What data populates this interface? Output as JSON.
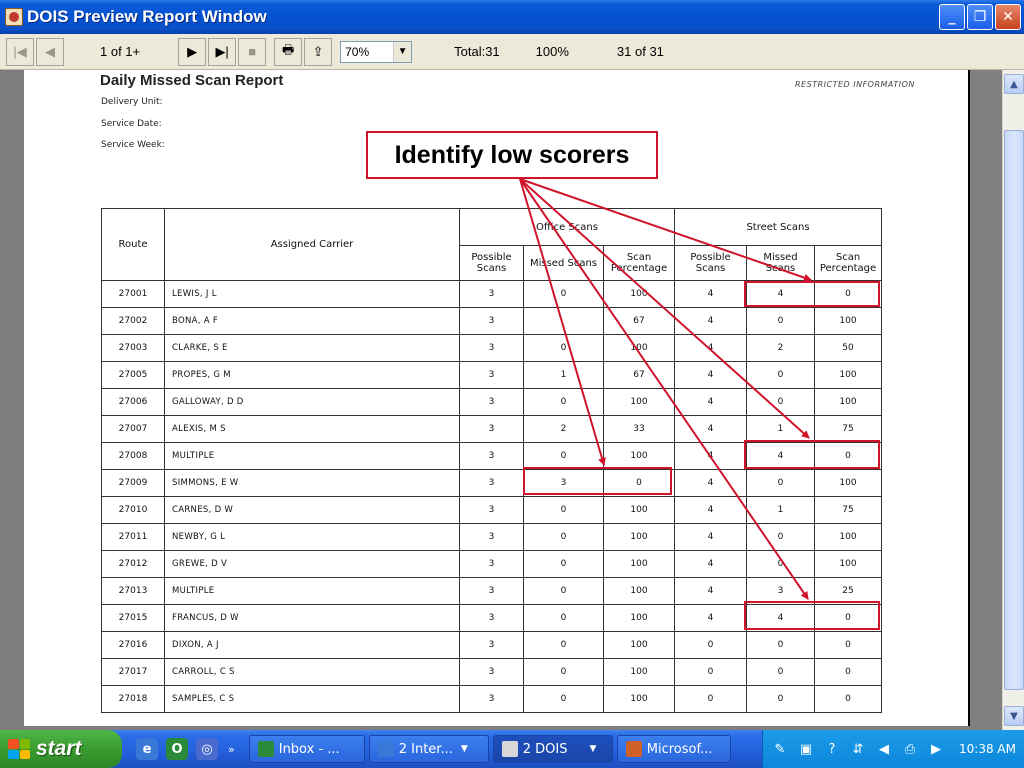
{
  "window": {
    "title": "DOIS Preview Report Window"
  },
  "toolbar": {
    "page_indicator": "1 of 1+",
    "zoom": "70%",
    "total": "Total:31",
    "percent": "100%",
    "count": "31 of 31"
  },
  "report": {
    "title": "Daily Missed Scan Report",
    "restricted": "RESTRICTED INFORMATION",
    "meta": [
      "Delivery Unit:",
      "Service Date:",
      "Service Week:"
    ],
    "headers": {
      "route": "Route",
      "carrier": "Assigned Carrier",
      "office": "Office Scans",
      "street": "Street Scans",
      "possible": "Possible Scans",
      "missed": "Missed Scans",
      "pct": "Scan Percentage"
    },
    "rows": [
      [
        "27001",
        "LEWIS, J L",
        "3",
        "0",
        "100",
        "4",
        "4",
        "0"
      ],
      [
        "27002",
        "BONA, A F",
        "3",
        "",
        "67",
        "4",
        "0",
        "100"
      ],
      [
        "27003",
        "CLARKE, S E",
        "3",
        "0",
        "100",
        "4",
        "2",
        "50"
      ],
      [
        "27005",
        "PROPES, G M",
        "3",
        "1",
        "67",
        "4",
        "0",
        "100"
      ],
      [
        "27006",
        "GALLOWAY, D D",
        "3",
        "0",
        "100",
        "4",
        "0",
        "100"
      ],
      [
        "27007",
        "ALEXIS, M S",
        "3",
        "2",
        "33",
        "4",
        "1",
        "75"
      ],
      [
        "27008",
        "MULTIPLE",
        "3",
        "0",
        "100",
        "4",
        "4",
        "0"
      ],
      [
        "27009",
        "SIMMONS, E W",
        "3",
        "3",
        "0",
        "4",
        "0",
        "100"
      ],
      [
        "27010",
        "CARNES, D W",
        "3",
        "0",
        "100",
        "4",
        "1",
        "75"
      ],
      [
        "27011",
        "NEWBY, G L",
        "3",
        "0",
        "100",
        "4",
        "0",
        "100"
      ],
      [
        "27012",
        "GREWE, D V",
        "3",
        "0",
        "100",
        "4",
        "0",
        "100"
      ],
      [
        "27013",
        "MULTIPLE",
        "3",
        "0",
        "100",
        "4",
        "3",
        "25"
      ],
      [
        "27015",
        "FRANCUS, D W",
        "3",
        "0",
        "100",
        "4",
        "4",
        "0"
      ],
      [
        "27016",
        "DIXON, A J",
        "3",
        "0",
        "100",
        "0",
        "0",
        "0"
      ],
      [
        "27017",
        "CARROLL, C S",
        "3",
        "0",
        "100",
        "0",
        "0",
        "0"
      ],
      [
        "27018",
        "SAMPLES, C S",
        "3",
        "0",
        "100",
        "0",
        "0",
        "0"
      ]
    ]
  },
  "callout": {
    "text": "Identify low scorers"
  },
  "taskbar": {
    "start": "start",
    "tasks": [
      {
        "label": "Inbox - ...",
        "icon_color": "#2a8a3a"
      },
      {
        "label": "2 Inter...",
        "icon_color": "#3a78d8"
      },
      {
        "label": "2 DOIS",
        "icon_color": "#d8d8d8"
      },
      {
        "label": "Microsof...",
        "icon_color": "#d0602a"
      }
    ],
    "clock": "10:38 AM"
  }
}
